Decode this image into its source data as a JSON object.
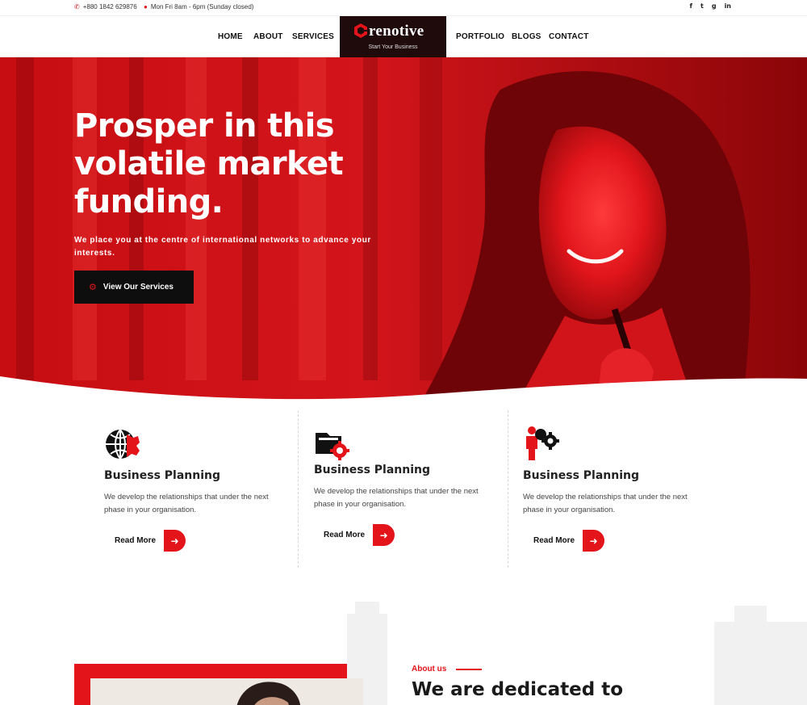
{
  "topbar": {
    "phone": "+880 1842 629876",
    "hours": "Mon Fri 8am - 6pm (Sunday closed)",
    "social": [
      "f",
      "t",
      "g",
      "in"
    ]
  },
  "nav": {
    "left_items": [
      "HOME",
      "ABOUT",
      "SERVICES"
    ],
    "right_items": [
      "PORTFOLIO",
      "BLOGS",
      "CONTACT"
    ],
    "logo_name": "renotive",
    "logo_tagline": "Start Your Business"
  },
  "hero": {
    "title_line1": "Prosper in this",
    "title_line2": "volatile market",
    "title_line3": "funding.",
    "subtitle": "We place you at the centre of international networks to advance your interests.",
    "button_label": "View Our Services"
  },
  "features": [
    {
      "icon": "globe-gear-icon",
      "title": "Business Planning",
      "text": "We develop the relationships that under the next phase in your organisation.",
      "link": "Read More"
    },
    {
      "icon": "folder-gear-icon",
      "title": "Business Planning",
      "text": "We develop the relationships that under the next phase in your organisation.",
      "link": "Read More"
    },
    {
      "icon": "person-gear-icon",
      "title": "Business Planning",
      "text": "We develop the relationships that under the next phase in your organisation.",
      "link": "Read More"
    }
  ],
  "about": {
    "label": "About us",
    "title": "We are dedicated to"
  },
  "colors": {
    "accent": "#e3141a",
    "dark": "#0e0e0e",
    "logo_bg": "#1f0a0c"
  }
}
